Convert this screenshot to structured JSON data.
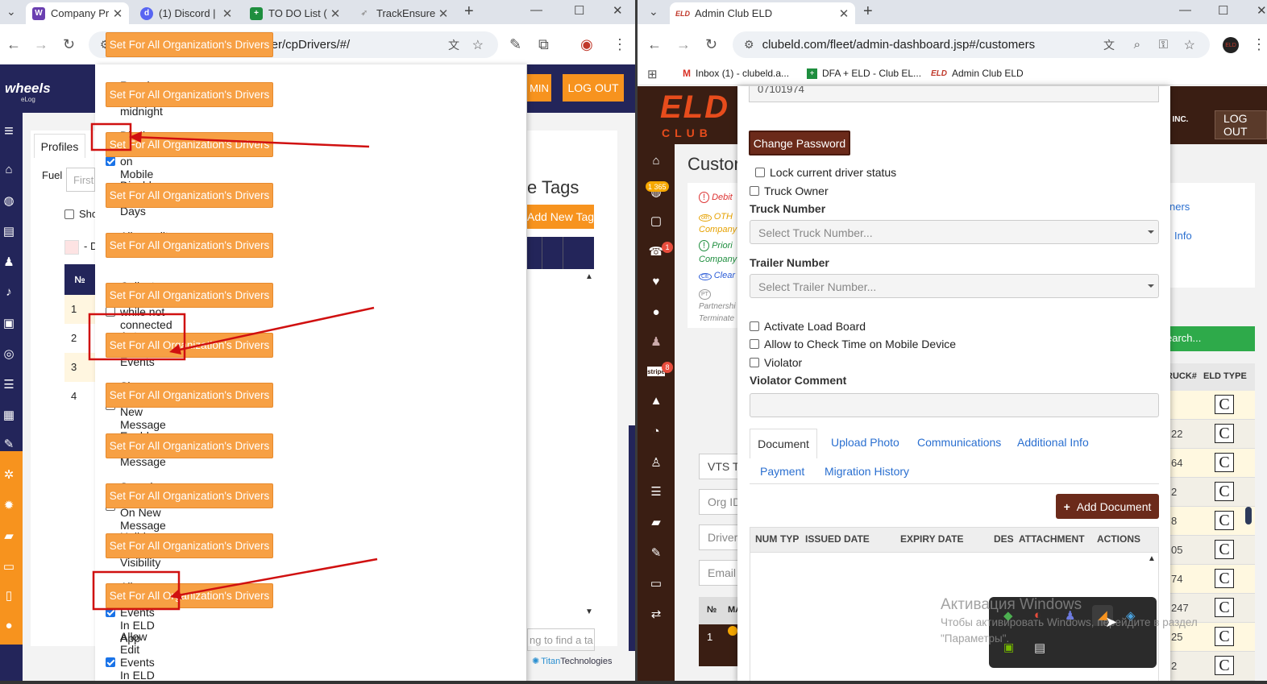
{
  "left": {
    "tabs": [
      {
        "label": "Company Pr"
      },
      {
        "label": "(1) Discord |"
      },
      {
        "label": "TO DO List ("
      },
      {
        "label": "TrackEnsure"
      }
    ],
    "url": "wheelselog.com/fleet/manager/cpDrivers/#/",
    "logo_text": "wheels",
    "logo_sub": "eLog",
    "admin_btn_partial": "MIN",
    "logout": "LOG OUT",
    "profiles_tab": "Profiles",
    "fuel_label": "Fuel",
    "first_placeholder": "First",
    "show_label": "Sho",
    "table_header": "№",
    "row_numbers": [
      "1",
      "2",
      "3",
      "4"
    ],
    "tags_title": "e Tags",
    "add_new_tag": "Add New Tag",
    "find_placeholder": "ng to find a ta",
    "titan_brand": "Titan",
    "titan_suffix": "Technologies",
    "dash_label": "- D",
    "options": [
      {
        "label": "Regain hours at midnight",
        "checked": false
      },
      {
        "label": "Display Time on Mobile Graph",
        "checked": true
      },
      {
        "label": "Disable 15 Days",
        "checked": false
      },
      {
        "label": "Allow edit information",
        "checked": false
      },
      {
        "label": "Collect GPS while not connected to Truck",
        "checked": false
      },
      {
        "label": "Auto-sync Events",
        "checked": true
      },
      {
        "label": "Show Alert On New Message",
        "checked": false
      },
      {
        "label": "Enable Voice Message",
        "checked": false
      },
      {
        "label": "Sound Notification On New Message",
        "checked": false
      },
      {
        "label": "Holiday Banner Visibility",
        "checked": false
      },
      {
        "label": "Allow Insert Events In ELD App",
        "checked": true
      },
      {
        "label": "Allow Edit Events In ELD App",
        "checked": true
      }
    ],
    "set_btn": "Set For All Organization's Drivers"
  },
  "right": {
    "tab": "Admin Club ELD",
    "url": "clubeld.com/fleet/admin-dashboard.jsp#/customers",
    "bookmarks": [
      {
        "label": "Inbox (1) - clubeld.a..."
      },
      {
        "label": "DFA + ELD - Club EL..."
      },
      {
        "label": "Admin Club ELD"
      }
    ],
    "logo_main": "ELD",
    "logo_sub": "CLUB",
    "company_partial": "S INC.",
    "logout": "LOG OUT",
    "page_title": "Custor",
    "badges": {
      "b1": "1 365",
      "b2": "1",
      "b3": "8"
    },
    "status_items": [
      "Debit",
      "OTH",
      "Company",
      "Priori",
      "Company",
      "Clear",
      "Partnershi",
      "Terminate"
    ],
    "top_field_value": "07101974",
    "change_password": "Change Password",
    "lock_status": "Lock current driver status",
    "truck_owner": "Truck Owner",
    "truck_number_label": "Truck Number",
    "truck_number_placeholder": "Select Truck Number...",
    "trailer_number_label": "Trailer Number",
    "trailer_number_placeholder": "Select Trailer Number...",
    "activate_load_board": "Activate Load Board",
    "allow_check_time": "Allow to Check Time on Mobile Device",
    "violator": "Violator",
    "violator_comment": "Violator Comment",
    "tabs": [
      "Document",
      "Upload Photo",
      "Communications",
      "Additional Info",
      "Payment",
      "Migration History"
    ],
    "add_document": "Add Document",
    "columns": [
      "NUM",
      "TYP",
      "ISSUED DATE",
      "EXPIRY DATE",
      "DES",
      "ATTACHMENT",
      "ACTIONS"
    ],
    "behind_fields": [
      "VTS Tr",
      "Org ID",
      "Driver",
      "Email"
    ],
    "behind_table_headers": [
      "№",
      "MA"
    ],
    "behind_row": "1",
    "links": [
      "ners",
      "Info"
    ],
    "search_btn": "earch...",
    "truck_col": "RUCK#",
    "eld_type_col": "ELD TYPE",
    "eld_rows": [
      "",
      "22",
      "64",
      "2",
      "8",
      "05",
      "74",
      "247",
      "25",
      "2"
    ],
    "eld_c": "C"
  },
  "windows_activation": {
    "title": "Активация Windows",
    "line1": "Чтобы активировать Windows, перейдите в раздел",
    "line2": "\"Параметры\"."
  }
}
